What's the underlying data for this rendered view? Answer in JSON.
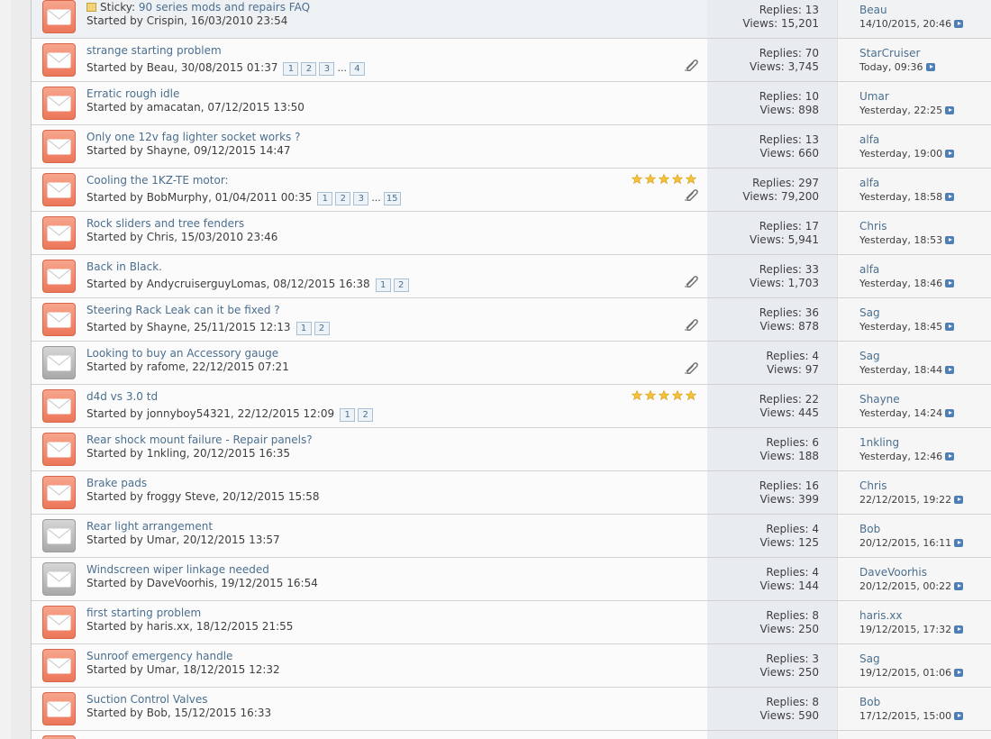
{
  "colors": {
    "link": "#4b6f8f",
    "envelope_new": "#ec7759",
    "envelope_read": "#a9a9a9",
    "stats_bg": "#e8ecf0"
  },
  "labels": {
    "replies": "Replies:",
    "views": "Views:",
    "started_by": "Started by",
    "sticky": "Sticky:"
  },
  "threads": [
    {
      "sticky": true,
      "status": "new",
      "title": "90 series mods and repairs FAQ",
      "author": "Crispin",
      "started": "16/03/2010 23:54",
      "pages": [],
      "attachment": false,
      "rating": 0,
      "replies": "13",
      "views": "15,201",
      "last_user": "Beau",
      "last_date": "14/10/2015, 20:46"
    },
    {
      "sticky": false,
      "status": "new",
      "title": "strange starting problem",
      "author": "Beau",
      "started": "30/08/2015 01:37",
      "pages": [
        "1",
        "2",
        "3",
        "...",
        "4"
      ],
      "attachment": true,
      "rating": 0,
      "replies": "70",
      "views": "3,745",
      "last_user": "StarCruiser",
      "last_date": "Today, 09:36"
    },
    {
      "sticky": false,
      "status": "new",
      "title": "Erratic rough idle",
      "author": "amacatan",
      "started": "07/12/2015 13:50",
      "pages": [],
      "attachment": false,
      "rating": 0,
      "replies": "10",
      "views": "898",
      "last_user": "Umar",
      "last_date": "Yesterday, 22:25"
    },
    {
      "sticky": false,
      "status": "new",
      "title": "Only one 12v fag lighter socket works ?",
      "author": "Shayne",
      "started": "09/12/2015 14:47",
      "pages": [],
      "attachment": false,
      "rating": 0,
      "replies": "13",
      "views": "660",
      "last_user": "alfa",
      "last_date": "Yesterday, 19:00"
    },
    {
      "sticky": false,
      "status": "new",
      "title": "Cooling the 1KZ-TE motor:",
      "author": "BobMurphy",
      "started": "01/04/2011 00:35",
      "pages": [
        "1",
        "2",
        "3",
        "...",
        "15"
      ],
      "attachment": true,
      "rating": 5,
      "replies": "297",
      "views": "79,200",
      "last_user": "alfa",
      "last_date": "Yesterday, 18:58"
    },
    {
      "sticky": false,
      "status": "new",
      "title": "Rock sliders and tree fenders",
      "author": "Chris",
      "started": "15/03/2010 23:46",
      "pages": [],
      "attachment": false,
      "rating": 0,
      "replies": "17",
      "views": "5,941",
      "last_user": "Chris",
      "last_date": "Yesterday, 18:53"
    },
    {
      "sticky": false,
      "status": "new",
      "title": "Back in Black.",
      "author": "AndycruiserguyLomas",
      "started": "08/12/2015 16:38",
      "pages": [
        "1",
        "2"
      ],
      "attachment": true,
      "rating": 0,
      "replies": "33",
      "views": "1,703",
      "last_user": "alfa",
      "last_date": "Yesterday, 18:46"
    },
    {
      "sticky": false,
      "status": "new",
      "title": "Steering Rack Leak can it be fixed ?",
      "author": "Shayne",
      "started": "25/11/2015 12:13",
      "pages": [
        "1",
        "2"
      ],
      "attachment": true,
      "rating": 0,
      "replies": "36",
      "views": "878",
      "last_user": "Sag",
      "last_date": "Yesterday, 18:45"
    },
    {
      "sticky": false,
      "status": "read",
      "title": "Looking to buy an Accessory gauge",
      "author": "rafome",
      "started": "22/12/2015 07:21",
      "pages": [],
      "attachment": true,
      "rating": 0,
      "replies": "4",
      "views": "97",
      "last_user": "Sag",
      "last_date": "Yesterday, 18:44"
    },
    {
      "sticky": false,
      "status": "new",
      "title": "d4d vs 3.0 td",
      "author": "jonnyboy54321",
      "started": "22/12/2015 12:09",
      "pages": [
        "1",
        "2"
      ],
      "attachment": false,
      "rating": 5,
      "replies": "22",
      "views": "445",
      "last_user": "Shayne",
      "last_date": "Yesterday, 14:24"
    },
    {
      "sticky": false,
      "status": "new",
      "title": "Rear shock mount failure - Repair panels?",
      "author": "1nkling",
      "started": "20/12/2015 16:35",
      "pages": [],
      "attachment": false,
      "rating": 0,
      "replies": "6",
      "views": "188",
      "last_user": "1nkling",
      "last_date": "Yesterday, 12:46"
    },
    {
      "sticky": false,
      "status": "new",
      "title": "Brake pads",
      "author": "froggy Steve",
      "started": "20/12/2015 15:58",
      "pages": [],
      "attachment": false,
      "rating": 0,
      "replies": "16",
      "views": "399",
      "last_user": "Chris",
      "last_date": "22/12/2015, 19:22"
    },
    {
      "sticky": false,
      "status": "read",
      "title": "Rear light arrangement",
      "author": "Umar",
      "started": "20/12/2015 13:57",
      "pages": [],
      "attachment": false,
      "rating": 0,
      "replies": "4",
      "views": "125",
      "last_user": "Bob",
      "last_date": "20/12/2015, 16:11"
    },
    {
      "sticky": false,
      "status": "read",
      "title": "Windscreen wiper linkage needed",
      "author": "DaveVoorhis",
      "started": "19/12/2015 16:54",
      "pages": [],
      "attachment": false,
      "rating": 0,
      "replies": "4",
      "views": "144",
      "last_user": "DaveVoorhis",
      "last_date": "20/12/2015, 00:22"
    },
    {
      "sticky": false,
      "status": "new",
      "title": "first starting problem",
      "author": "haris.xx",
      "started": "18/12/2015 21:55",
      "pages": [],
      "attachment": false,
      "rating": 0,
      "replies": "8",
      "views": "250",
      "last_user": "haris.xx",
      "last_date": "19/12/2015, 17:32"
    },
    {
      "sticky": false,
      "status": "new",
      "title": "Sunroof emergency handle",
      "author": "Umar",
      "started": "18/12/2015 12:32",
      "pages": [],
      "attachment": false,
      "rating": 0,
      "replies": "3",
      "views": "250",
      "last_user": "Sag",
      "last_date": "19/12/2015, 01:06"
    },
    {
      "sticky": false,
      "status": "new",
      "title": "Suction Control Valves",
      "author": "Bob",
      "started": "15/12/2015 16:33",
      "pages": [],
      "attachment": false,
      "rating": 0,
      "replies": "8",
      "views": "590",
      "last_user": "Bob",
      "last_date": "17/12/2015, 15:00"
    },
    {
      "sticky": false,
      "status": "new",
      "title": "",
      "author": "",
      "started": "",
      "pages": [],
      "attachment": false,
      "rating": 0,
      "replies": "",
      "views": "",
      "last_user": "",
      "last_date": ""
    }
  ]
}
